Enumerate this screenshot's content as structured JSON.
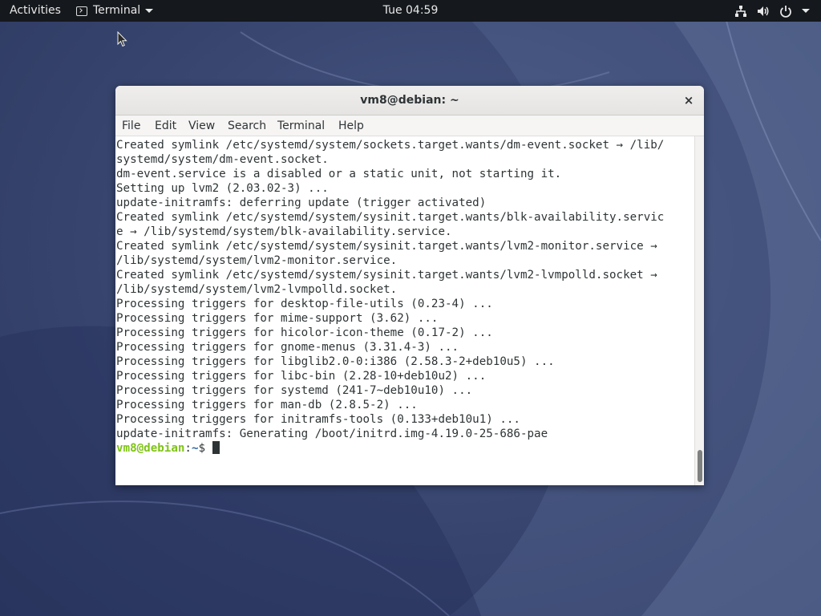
{
  "topbar": {
    "activities": "Activities",
    "app_name": "Terminal",
    "clock": "Tue 04:59",
    "status_icons": [
      "network-icon",
      "volume-icon",
      "power-icon",
      "chevron-down-icon"
    ]
  },
  "window": {
    "title": "vm8@debian: ~",
    "close_label": "×",
    "menu": [
      "File",
      "Edit",
      "View",
      "Search",
      "Terminal",
      "Help"
    ]
  },
  "terminal": {
    "lines": [
      "Created symlink /etc/systemd/system/sockets.target.wants/dm-event.socket → /lib/",
      "systemd/system/dm-event.socket.",
      "dm-event.service is a disabled or a static unit, not starting it.",
      "Setting up lvm2 (2.03.02-3) ...",
      "update-initramfs: deferring update (trigger activated)",
      "Created symlink /etc/systemd/system/sysinit.target.wants/blk-availability.servic",
      "e → /lib/systemd/system/blk-availability.service.",
      "Created symlink /etc/systemd/system/sysinit.target.wants/lvm2-monitor.service →",
      "/lib/systemd/system/lvm2-monitor.service.",
      "Created symlink /etc/systemd/system/sysinit.target.wants/lvm2-lvmpolld.socket →",
      "/lib/systemd/system/lvm2-lvmpolld.socket.",
      "Processing triggers for desktop-file-utils (0.23-4) ...",
      "Processing triggers for mime-support (3.62) ...",
      "Processing triggers for hicolor-icon-theme (0.17-2) ...",
      "Processing triggers for gnome-menus (3.31.4-3) ...",
      "Processing triggers for libglib2.0-0:i386 (2.58.3-2+deb10u5) ...",
      "Processing triggers for libc-bin (2.28-10+deb10u2) ...",
      "Processing triggers for systemd (241-7~deb10u10) ...",
      "Processing triggers for man-db (2.8.5-2) ...",
      "Processing triggers for initramfs-tools (0.133+deb10u1) ...",
      "update-initramfs: Generating /boot/initrd.img-4.19.0-25-686-pae"
    ],
    "prompt_user": "vm8@debian",
    "prompt_sep": ":",
    "prompt_path": "~",
    "prompt_symbol": "$ ",
    "prompt_user_color": "#7fc416",
    "prompt_path_color": "#3465a4"
  }
}
